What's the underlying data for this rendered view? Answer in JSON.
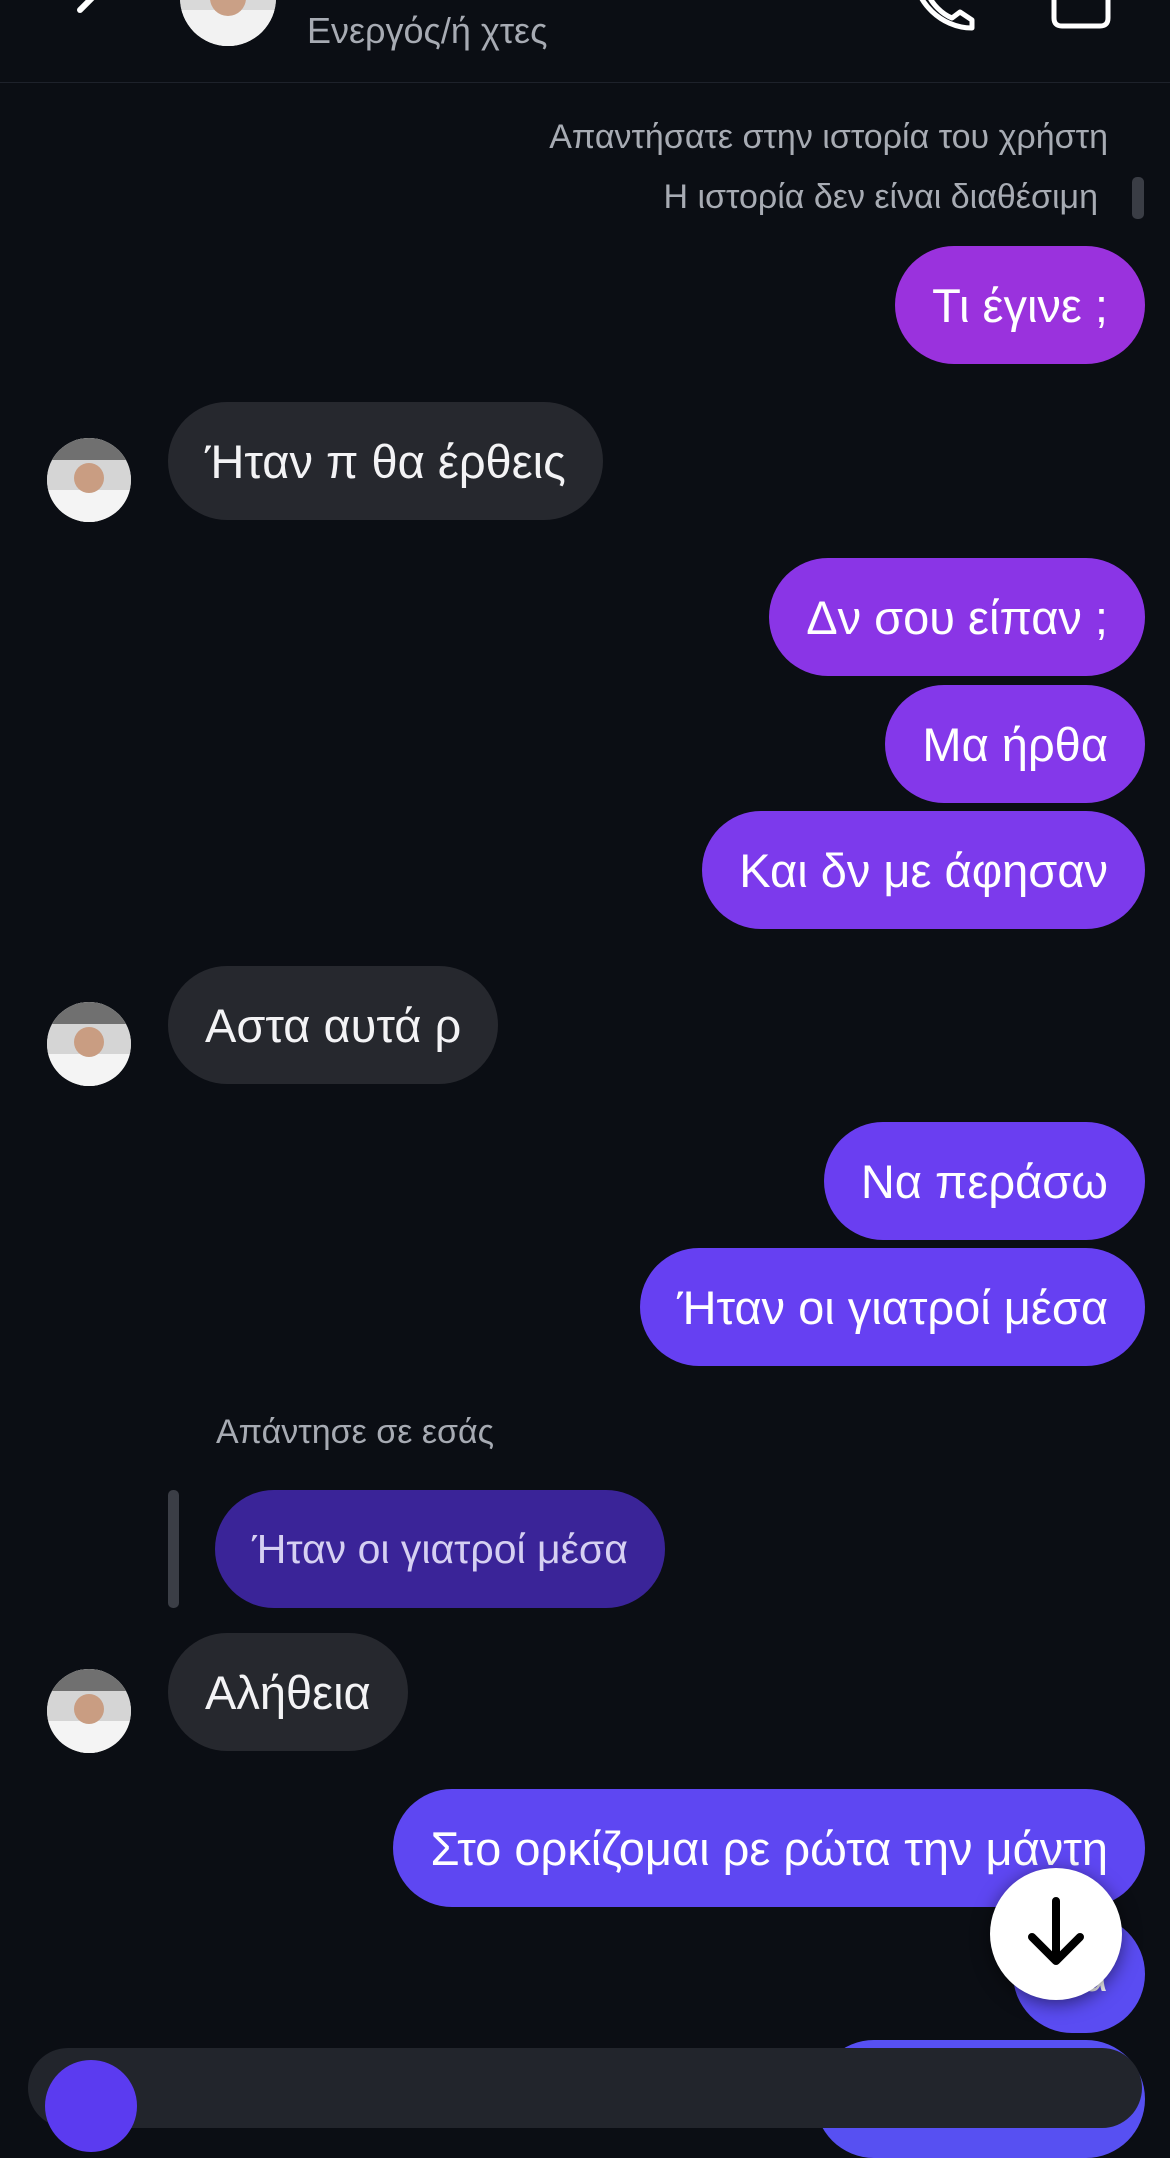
{
  "header": {
    "status": "Ενεργός/ή χτες"
  },
  "system": {
    "replied_to_story": "Απαντήσατε στην ιστορία του χρήστη",
    "story_unavailable": "Η ιστορία δεν είναι διαθέσιμη"
  },
  "messages": [
    {
      "from": "me",
      "text": "Τι έγινε ;",
      "color": "#9a32dd"
    },
    {
      "from": "them",
      "text": "Ήταν π θα έρθεις"
    },
    {
      "from": "me",
      "text": "Δν σου είπαν ;",
      "color": "#8a35e6"
    },
    {
      "from": "me",
      "text": "Μα ήρθα",
      "color": "#8438ea"
    },
    {
      "from": "me",
      "text": "Και δν με άφησαν",
      "color": "#7c3aec"
    },
    {
      "from": "them",
      "text": "Αστα αυτά ρ"
    },
    {
      "from": "me",
      "text": "Να περάσω",
      "color": "#6a3ef1"
    },
    {
      "from": "me",
      "text": "Ήταν οι γιατροί μέσα",
      "color": "#6640f2"
    },
    {
      "from": "them",
      "text": "Αλήθεια",
      "reply_label": "Απάντησε σε εσάς",
      "reply_quote": "Ήταν οι γιατροί μέσα"
    },
    {
      "from": "me",
      "text": "Στο ορκίζομαι ρε ρώτα την μάντη",
      "color": "#5e47f2"
    },
    {
      "from": "me",
      "text": "Κα",
      "color": "#5a4cf2"
    }
  ],
  "icons": {
    "back": "chevron-left-icon",
    "call": "phone-icon",
    "video": "video-camera-icon",
    "scroll": "arrow-down-icon"
  }
}
